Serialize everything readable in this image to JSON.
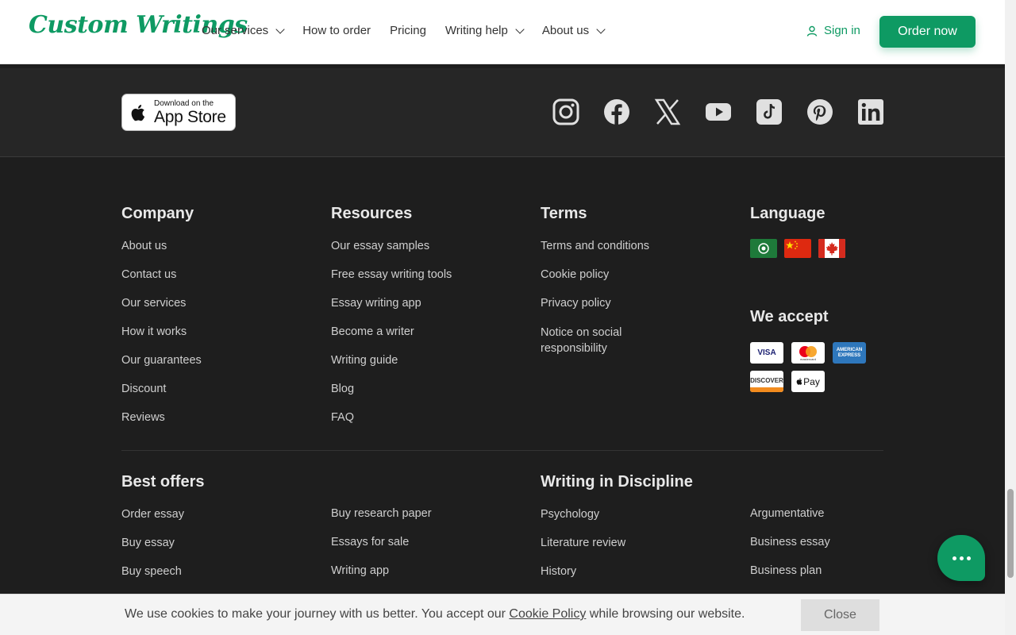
{
  "header": {
    "logo": "Custom Writings",
    "nav": [
      {
        "label": "Our services",
        "dropdown": true
      },
      {
        "label": "How to order",
        "dropdown": false
      },
      {
        "label": "Pricing",
        "dropdown": false
      },
      {
        "label": "Writing help",
        "dropdown": true
      },
      {
        "label": "About us",
        "dropdown": true
      }
    ],
    "sign_in": "Sign in",
    "order_now": "Order now"
  },
  "app_strip": {
    "appstore_small": "Download on the",
    "appstore_big": "App Store",
    "social": [
      "instagram-icon",
      "facebook-icon",
      "x-icon",
      "youtube-icon",
      "tiktok-icon",
      "pinterest-icon",
      "linkedin-icon"
    ]
  },
  "footer": {
    "company": {
      "title": "Company",
      "links": [
        "About us",
        "Contact us",
        "Our services",
        "How it works",
        "Our guarantees",
        "Discount",
        "Reviews"
      ]
    },
    "resources": {
      "title": "Resources",
      "links": [
        "Our essay samples",
        "Free essay writing tools",
        "Essay writing app",
        "Become a writer",
        "Writing guide",
        "Blog",
        "FAQ"
      ]
    },
    "terms": {
      "title": "Terms",
      "links": [
        "Terms and conditions",
        "Cookie policy",
        "Privacy policy",
        "Notice on social responsibility"
      ]
    },
    "language": {
      "title": "Language",
      "flags": [
        "arabic-flag-icon",
        "china-flag-icon",
        "canada-flag-icon"
      ]
    },
    "accept": {
      "title": "We accept",
      "cards": [
        "VISA",
        "mastercard",
        "AMERICAN EXPRESS",
        "DISCOVER",
        "Pay"
      ]
    },
    "best_offers": {
      "title": "Best offers",
      "col1": [
        "Order essay",
        "Buy essay",
        "Buy speech"
      ],
      "col2": [
        "Buy research paper",
        "Essays for sale",
        "Writing app"
      ]
    },
    "discipline": {
      "title": "Writing in Discipline",
      "col1": [
        "Psychology",
        "Literature review",
        "History"
      ],
      "col2": [
        "Argumentative",
        "Business essay",
        "Business plan"
      ]
    }
  },
  "cookie": {
    "text_before": "We use cookies to make your journey with us better. You accept our ",
    "link": "Cookie Policy",
    "text_after": " while browsing our website.",
    "close": "Close"
  },
  "colors": {
    "brand": "#0e9a63",
    "footer_bg": "#1e1e1e",
    "strip_bg": "#262626"
  }
}
